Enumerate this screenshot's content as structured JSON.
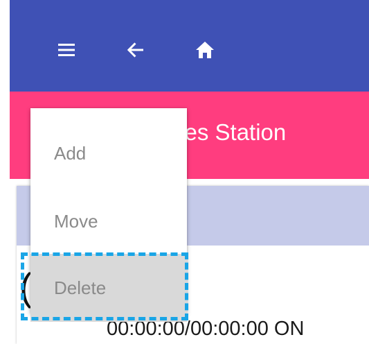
{
  "appbar": {
    "color": "#3F51B5",
    "icons": [
      "menu-icon",
      "back-arrow-icon",
      "home-icon"
    ]
  },
  "titlebar": {
    "color": "#FF3D7F",
    "title_partial": "ses Station"
  },
  "content": {
    "row_color": "#C5CAE9",
    "paren": "(",
    "datetime": "00:00:00/00:00:00 ON"
  },
  "menu": {
    "items": [
      {
        "label": "Add"
      },
      {
        "label": "Move"
      },
      {
        "label": "Delete",
        "selected": true
      }
    ],
    "highlight_color": "#1AA5E6"
  }
}
